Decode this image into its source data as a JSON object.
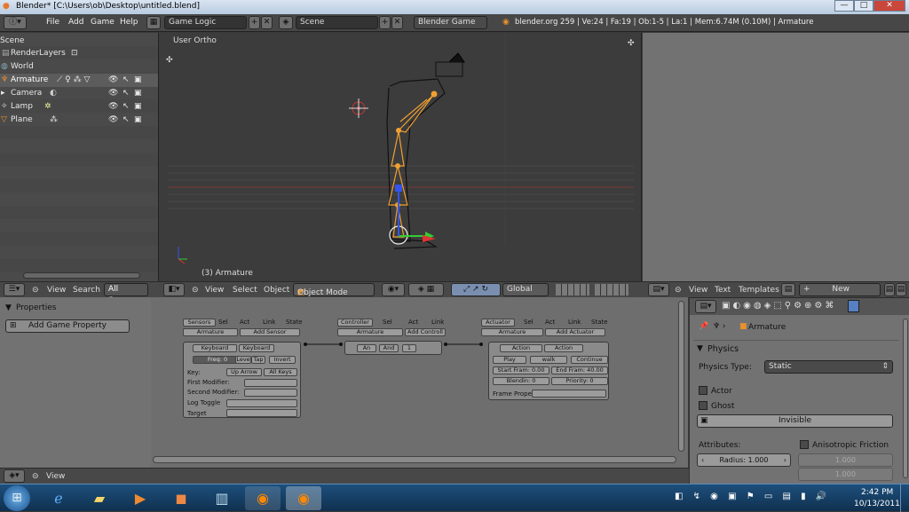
{
  "window": {
    "title": "Blender* [C:\\Users\\ob\\Desktop\\untitled.blend]",
    "min": "—",
    "max": "□",
    "close": "✕"
  },
  "menubar": {
    "menus": [
      "File",
      "Add",
      "Game",
      "Help"
    ],
    "screen": "Game Logic",
    "scene": "Scene",
    "engine": "Blender Game",
    "stats": "blender.org 259 | Ve:24 | Fa:19 | Ob:1-5 | La:1 | Mem:6.74M (0.10M) | Armature"
  },
  "outliner": {
    "root": "Scene",
    "items": [
      "RenderLayers",
      "World",
      "Armature",
      "Camera",
      "Lamp",
      "Plane"
    ],
    "header": {
      "view": "View",
      "search": "Search",
      "scenes": "All Scenes"
    }
  },
  "viewport": {
    "label": "User Ortho",
    "object_label": "(3) Armature",
    "header": {
      "view": "View",
      "select": "Select",
      "object": "Object",
      "mode": "Object Mode",
      "orientation": "Global"
    }
  },
  "text_header": {
    "view": "View",
    "text": "Text",
    "templates": "Templates",
    "new": "New"
  },
  "properties_left": {
    "title": "Properties",
    "add": "Add Game Property"
  },
  "logic": {
    "sensors": {
      "title": "Sensors",
      "sel": "Sel",
      "act": "Act",
      "link": "Link",
      "state": "State",
      "object": "Armature",
      "add": "Add Sensor",
      "brick": {
        "type": "Keyboard",
        "name": "Keyboard",
        "freq": "Freq: 0",
        "level": "Leve",
        "tap": "Tap",
        "invert": "Invert",
        "key_label": "Key:",
        "key": "Up Arrow",
        "all_keys": "All Keys",
        "first": "First Modifier:",
        "second": "Second Modifier:",
        "log": "Log Toggle",
        "target": "Target"
      }
    },
    "controllers": {
      "title": "Controller",
      "sel": "Sel",
      "act": "Act",
      "link": "Link",
      "object": "Armature",
      "add": "Add Controll",
      "brick": {
        "type": "An",
        "name": "And",
        "num": "1"
      }
    },
    "actuators": {
      "title": "Actuator",
      "sel": "Sel",
      "act": "Act",
      "link": "Link",
      "state": "State",
      "object": "Armature",
      "add": "Add Actuator",
      "brick": {
        "type": "Action",
        "name": "Action",
        "play": "Play",
        "action": "walk",
        "continue": "Continue",
        "start": "Start Fram: 0.00",
        "end": "End Fram: 40.00",
        "blendin": "Blendin: 0",
        "priority": "Priority: 0",
        "frame_prop": "Frame Prope"
      }
    },
    "footer_view": "View"
  },
  "properties_right": {
    "object": "Armature",
    "section": "Physics",
    "type_label": "Physics Type:",
    "type_value": "Static",
    "actor": "Actor",
    "ghost": "Ghost",
    "invisible": "Invisible",
    "attributes": "Attributes:",
    "radius": "Radius: 1.000",
    "aniso": "Anisotropic Friction",
    "v1": "1.000",
    "v2": "1.000"
  },
  "taskbar": {
    "time": "2:42 PM",
    "date": "10/13/2011"
  },
  "colors": {
    "accent": "#e8912d",
    "selected": "#5680c2",
    "bone": "#f0a030"
  }
}
